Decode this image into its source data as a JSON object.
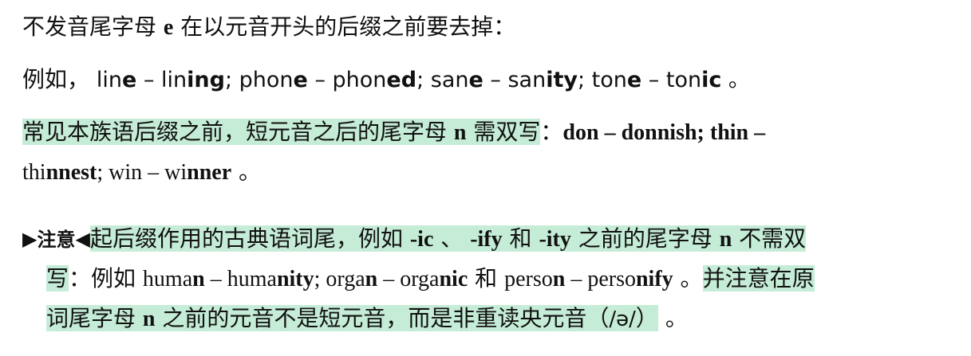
{
  "rule1": {
    "text_before": "不发音尾字母 ",
    "letter": "e",
    "text_after": " 在以元音开头的后缀之前要去掉："
  },
  "example1": {
    "lead": "例如，",
    "items": [
      {
        "a_base": "lin",
        "a_end": "e",
        "dash": " – ",
        "b_base": "lin",
        "b_end": "ing",
        "sep": "; "
      },
      {
        "a_base": "phon",
        "a_end": "e",
        "dash": " – ",
        "b_base": "phon",
        "b_end": "ed",
        "sep": "; "
      },
      {
        "a_base": "san",
        "a_end": "e",
        "dash": " – ",
        "b_base": "san",
        "b_end": "ity",
        "sep": "; "
      },
      {
        "a_base": "ton",
        "a_end": "e",
        "dash": " – ",
        "b_base": "ton",
        "b_end": "ic",
        "sep": " 。"
      }
    ]
  },
  "rule2": {
    "highlighted": "常见本族语后缀之前，短元音之后的尾字母 ",
    "highlighted_letter": "n",
    "highlighted_tail": " 需双写",
    "colon": "：",
    "ex1_a": "don",
    "ex1_dash": " – ",
    "ex1_b_base": "do",
    "ex1_b_bold": "nnish",
    "ex1_sep": "; ",
    "ex2_a": "thin",
    "ex2_dash": " –",
    "ex2_b_base": "thi",
    "ex2_b_bold": "nnest",
    "ex2_sep": "; ",
    "ex3_a": "win",
    "ex3_dash": " – ",
    "ex3_b_base": "wi",
    "ex3_b_bold": "nner",
    "end": " 。"
  },
  "note": {
    "arrow_left": "▶",
    "label": "注意",
    "arrow_right": "◀",
    "hl1": "起后缀作用的古典语词尾，例如 ",
    "suffix1": "-ic",
    "sep1": " 、 ",
    "suffix2": "-ify",
    "and1": " 和 ",
    "suffix3": "-ity",
    "hl1_tail": " 之前的尾字母 ",
    "letter": "n",
    "hl1_end": " 不需双",
    "line2_hl": "写",
    "line2_lead": "：例如 ",
    "ex1_a_base": "huma",
    "ex1_a_bold": "n",
    "ex1_dash": " – ",
    "ex1_b_base": "huma",
    "ex1_b_bold": "nity",
    "ex1_sep": "; ",
    "ex2_a_base": "orga",
    "ex2_a_bold": "n",
    "ex2_dash": " – ",
    "ex2_b_base": "orga",
    "ex2_b_bold": "nic",
    "ex2_and": " 和 ",
    "ex3_a_base": "perso",
    "ex3_a_bold": "n",
    "ex3_dash": " – ",
    "ex3_b_base": "perso",
    "ex3_b_bold": "nify",
    "ex3_end": " 。",
    "hl2": "并注意在原",
    "line3_hl_a": "词尾字母 ",
    "line3_hl_letter": "n",
    "line3_hl_b": " 之前的元音不是短元音，而是非重读央元音（",
    "ipa": "/ə/",
    "line3_hl_c": "）",
    "line3_end": " 。"
  }
}
